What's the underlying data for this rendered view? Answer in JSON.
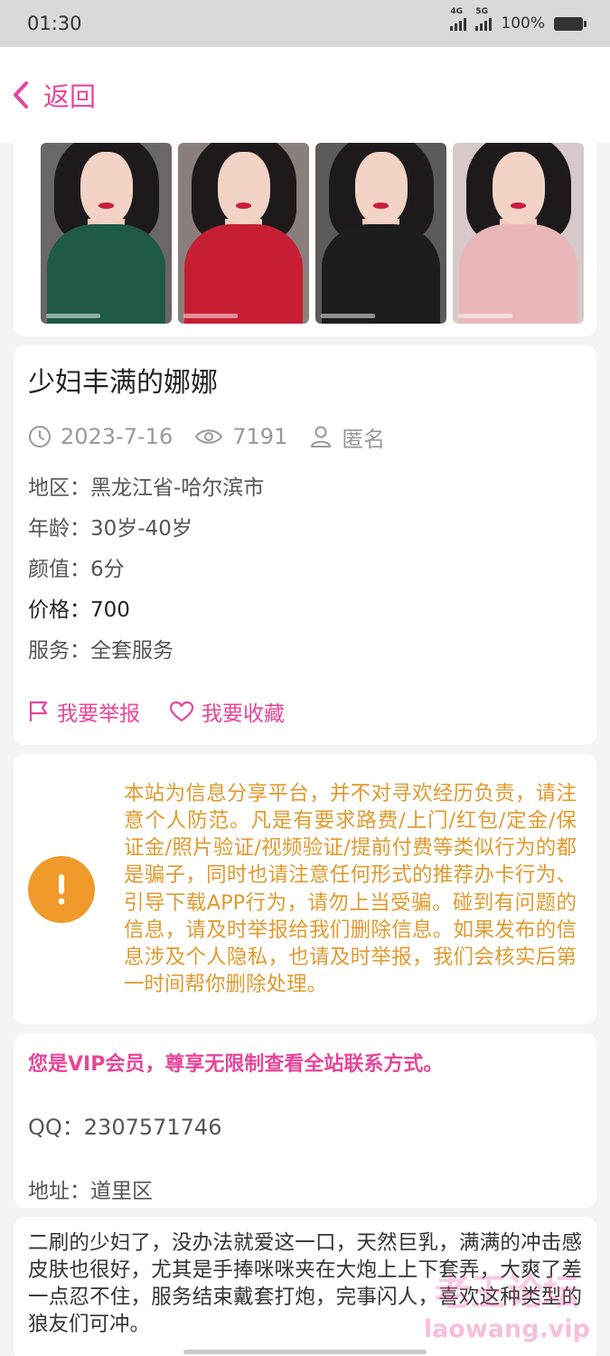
{
  "status_bar": {
    "time": "01:30",
    "network_1": "4G",
    "network_2": "5G",
    "battery": "100%"
  },
  "nav": {
    "back_label": "返回",
    "accent": "#e8459a"
  },
  "gallery": {
    "photos": [
      {
        "outfit_color": "#1f5a45"
      },
      {
        "outfit_color": "#c61f33"
      },
      {
        "outfit_color": "#1d1d1d"
      },
      {
        "outfit_color": "#e9b7b9"
      }
    ]
  },
  "post": {
    "title": "少妇丰满的娜娜",
    "date": "2023-7-16",
    "views": "7191",
    "author": "匿名",
    "fields": [
      {
        "label": "地区：",
        "value": "黑龙江省-哈尔滨市"
      },
      {
        "label": "年龄：",
        "value": "30岁-40岁"
      },
      {
        "label": "颜值：",
        "value": "6分"
      },
      {
        "label": "价格：",
        "value": "700"
      },
      {
        "label": "服务：",
        "value": "全套服务"
      }
    ],
    "report_label": "我要举报",
    "favorite_label": "我要收藏"
  },
  "notice": {
    "text": "本站为信息分享平台，并不对寻欢经历负责，请注意个人防范。凡是有要求路费/上门/红包/定金/保证金/照片验证/视频验证/提前付费等类似行为的都是骗子，同时也请注意任何形式的推荐办卡行为、引导下载APP行为，请勿上当受骗。碰到有问题的信息，请及时举报给我们删除信息。如果发布的信息涉及个人隐私，也请及时举报，我们会核实后第一时间帮你删除处理。",
    "icon_color": "#ef9a2b",
    "text_color": "#e09a2e"
  },
  "contact": {
    "vip_text": "您是VIP会员，尊享无限制查看全站联系方式。",
    "qq": "QQ：2307571746",
    "address": "地址：道里区"
  },
  "description": {
    "text": "二刷的少妇了，没办法就爱这一口，天然巨乳，满满的冲击感皮肤也很好，尤其是手捧咪咪夹在大炮上上下套弄，大爽了差一点忍不住，服务结束戴套打炮，完事闪人，喜欢这种类型的狼友们可冲。"
  },
  "watermark": {
    "name": "老王论坛",
    "url": "laowang.vip"
  }
}
